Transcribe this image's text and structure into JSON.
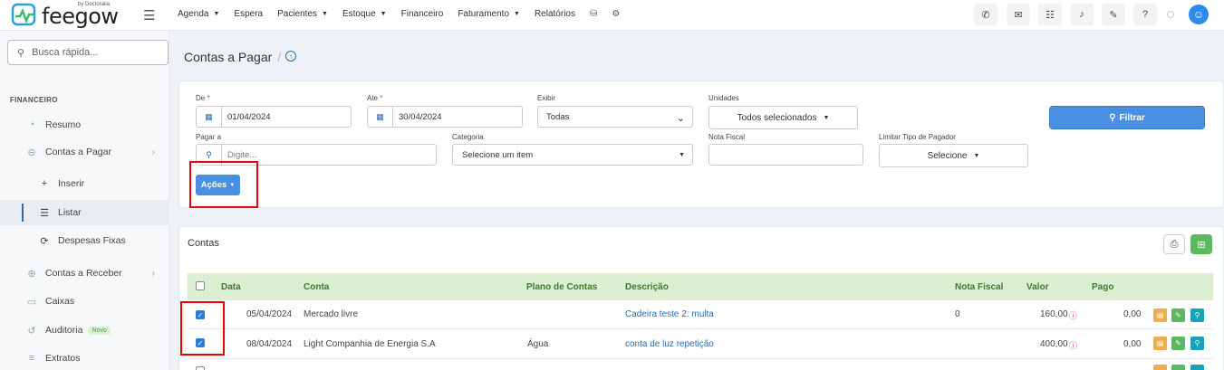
{
  "brand": {
    "name": "feegow",
    "by": "by Doctoralia"
  },
  "nav": [
    {
      "label": "Agenda",
      "caret": true
    },
    {
      "label": "Espera",
      "caret": false
    },
    {
      "label": "Pacientes",
      "caret": true
    },
    {
      "label": "Estoque",
      "caret": true
    },
    {
      "label": "Financeiro",
      "caret": false
    },
    {
      "label": "Faturamento",
      "caret": true
    },
    {
      "label": "Relatórios",
      "caret": false
    }
  ],
  "sidebar": {
    "search_placeholder": "Busca rápida...",
    "section": "FINANCEIRO",
    "items": {
      "resumo": "Resumo",
      "contas_pagar": "Contas a Pagar",
      "inserir": "Inserir",
      "listar": "Listar",
      "despesas_fixas": "Despesas Fixas",
      "contas_receber": "Contas a Receber",
      "caixas": "Caixas",
      "auditoria": "Auditoria",
      "auditoria_badge": "Novo",
      "extratos": "Extratos"
    }
  },
  "page": {
    "title": "Contas a Pagar",
    "sep": "/"
  },
  "filters": {
    "de_label": "De",
    "de_value": "01/04/2024",
    "ate_label": "Ate",
    "ate_value": "30/04/2024",
    "exibir_label": "Exibir",
    "exibir_value": "Todas",
    "unidades_label": "Unidades",
    "unidades_value": "Todos selecionados",
    "filtrar": "Filtrar",
    "pagar_a_label": "Pagar a",
    "pagar_a_placeholder": "Digite...",
    "categoria_label": "Categoria",
    "categoria_value": "Selecione um item",
    "nota_fiscal_label": "Nota Fiscal",
    "limitar_label": "Limitar Tipo de Pagador",
    "limitar_value": "Selecione",
    "acoes": "Ações"
  },
  "contas": {
    "title": "Contas",
    "headers": {
      "data": "Data",
      "conta": "Conta",
      "plano": "Plano de Contas",
      "descricao": "Descrição",
      "nota": "Nota Fiscal",
      "valor": "Valor",
      "pago": "Pago"
    },
    "rows": [
      {
        "checked": true,
        "data": "05/04/2024",
        "conta": "Mercado livre",
        "plano": "",
        "descricao": "Cadeira teste 2: multa",
        "nota": "0",
        "valor": "160,00",
        "pago": "0,00"
      },
      {
        "checked": true,
        "data": "08/04/2024",
        "conta": "Light Companhia de Energia S.A",
        "plano": "Água",
        "descricao": "conta de luz repetição",
        "nota": "",
        "valor": "400,00",
        "pago": "0,00"
      }
    ]
  },
  "colors": {
    "accent": "#4a90e2",
    "table_header": "#dcefd2",
    "highlight": "#e00000"
  }
}
